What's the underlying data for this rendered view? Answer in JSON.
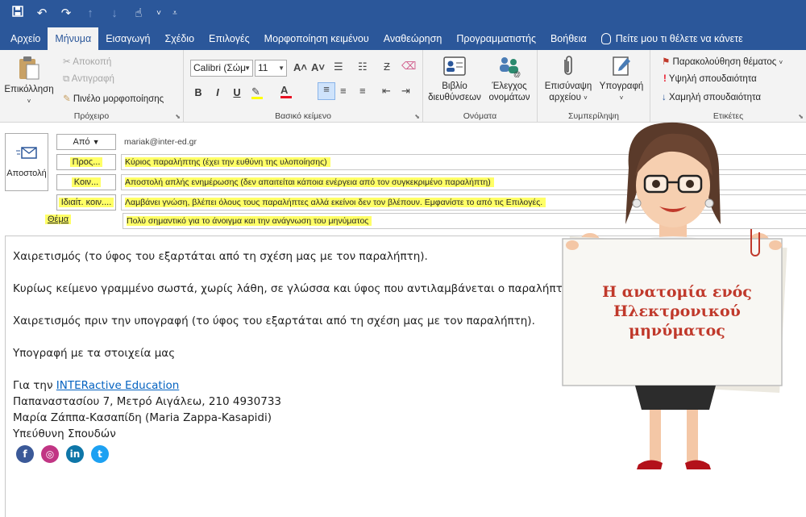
{
  "quick_access": {
    "icons": [
      "save-icon",
      "undo-icon",
      "redo-icon",
      "arrow-up-icon",
      "arrow-down-icon",
      "touch-mode-icon",
      "customize-icon"
    ]
  },
  "tabs": [
    {
      "label": "Αρχείο"
    },
    {
      "label": "Μήνυμα"
    },
    {
      "label": "Εισαγωγή"
    },
    {
      "label": "Σχέδιο"
    },
    {
      "label": "Επιλογές"
    },
    {
      "label": "Μορφοποίηση κειμένου"
    },
    {
      "label": "Αναθεώρηση"
    },
    {
      "label": "Προγραμματιστής"
    },
    {
      "label": "Βοήθεια"
    },
    {
      "label": "Πείτε μου τι θέλετε να κάνετε"
    }
  ],
  "ribbon": {
    "clipboard": {
      "paste": "Επικόλληση",
      "cut": "Αποκοπή",
      "copy": "Αντιγραφή",
      "format_painter": "Πινέλο μορφοποίησης",
      "group": "Πρόχειρο"
    },
    "basic_text": {
      "font": "Calibri (Σώμ",
      "size": "11",
      "bold": "B",
      "italic": "I",
      "underline": "U",
      "group": "Βασικό κείμενο"
    },
    "names": {
      "address_book_1": "Βιβλίο",
      "address_book_2": "διευθύνσεων",
      "check_names_1": "Έλεγχος",
      "check_names_2": "ονομάτων",
      "group": "Ονόματα"
    },
    "include": {
      "attach_1": "Επισύναψη",
      "attach_2": "αρχείου",
      "signature": "Υπογραφή",
      "group": "Συμπερίληψη"
    },
    "tags": {
      "follow_up": "Παρακολούθηση θέματος",
      "high": "Υψηλή σπουδαιότητα",
      "low": "Χαμηλή σπουδαιότητα",
      "group": "Ετικέτες"
    }
  },
  "compose": {
    "send": "Αποστολή",
    "from_label": "Από",
    "from_value": "mariak@inter-ed.gr",
    "to_label": "Προς...",
    "to_value": "Κύριος παραλήπτης (έχει την ευθύνη της υλοποίησης)",
    "cc_label": "Κοιν...",
    "cc_value": "Αποστολή απλής ενημέρωσης (δεν απαιτείται κάποια ενέργεια από τον συγκεκριμένο παραλήπτη)",
    "bcc_label": "Ιδιαίτ. κοιν....",
    "bcc_value": "Λαμβάνει γνώση, βλέπει όλους τους παραλήπτες αλλά εκείνοι δεν τον βλέπουν. Εμφανίστε το από τις Επιλογές.",
    "subject_label": "Θέμα",
    "subject_value": "Πολύ σημαντικό για το άνοιγμα και την ανάγνωση του μηνύματος"
  },
  "body": {
    "greeting": "Χαιρετισμός (το ύφος του εξαρτάται από τη σχέση μας με τον παραλήπτη).",
    "main": "Κυρίως κείμενο γραμμένο σωστά, χωρίς λάθη, σε γλώσσα και ύφος που αντιλαμβάνεται ο παραλήπτης.",
    "closing": "Χαιρετισμός πριν την υπογραφή (το ύφος του εξαρτάται από τη σχέση μας με τον παραλήπτη).",
    "signature_note": "Υπογραφή με τα στοιχεία μας",
    "sig_prefix": "Για την ",
    "sig_link": "INTERactive Education",
    "sig_address": "Παπαναστασίου 7, Μετρό Αιγάλεω, 210 4930733",
    "sig_name": "Μαρία Ζάππα-Κασαπίδη (Maria Zappa-Kasapidi)",
    "sig_role": "Υπεύθυνη Σπουδών",
    "social": [
      {
        "name": "facebook-icon",
        "glyph": "f",
        "color": "#3b5998"
      },
      {
        "name": "instagram-icon",
        "glyph": "◎",
        "color": "#c13584"
      },
      {
        "name": "linkedin-icon",
        "glyph": "in",
        "color": "#0e76a8"
      },
      {
        "name": "twitter-icon",
        "glyph": "t",
        "color": "#1da1f2"
      }
    ]
  },
  "illustration": {
    "sign_line1": "Η ανατομία ενός",
    "sign_line2": "Ηλεκτρονικού",
    "sign_line3": "μηνύματος"
  }
}
